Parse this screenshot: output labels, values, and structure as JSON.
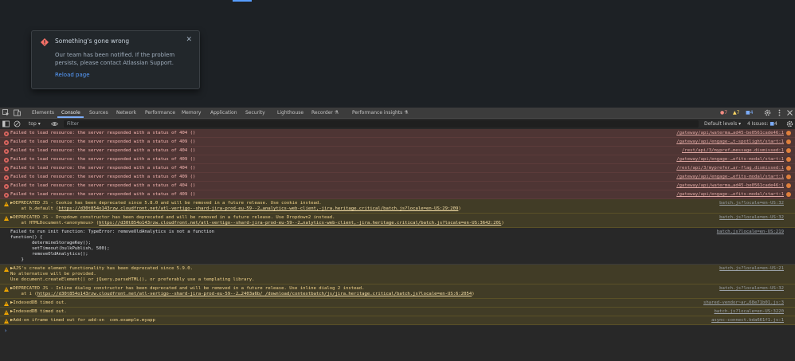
{
  "page": {
    "flag": {
      "title": "Something's gone wrong",
      "body": "Our team has been notified. If the problem persists, please contact Atlassian Support.",
      "link": "Reload page",
      "close": "✕"
    }
  },
  "devtools": {
    "tabs": [
      {
        "label": "Elements"
      },
      {
        "label": "Console"
      },
      {
        "label": "Sources"
      },
      {
        "label": "Network"
      },
      {
        "label": "Performance"
      },
      {
        "label": "Memory"
      },
      {
        "label": "Application"
      },
      {
        "label": "Security"
      },
      {
        "label": "Lighthouse"
      },
      {
        "label": "Recorder ⚗"
      },
      {
        "label": "Performance insights ⚗"
      }
    ],
    "counts": {
      "errors": "7",
      "warnings": "7",
      "messages": "4"
    },
    "filter": {
      "context": "top",
      "placeholder": "Filter",
      "levels": "Default levels ▾",
      "issues_label": "4 Issues:",
      "issues_count": "4"
    },
    "prompt": "›",
    "logs": [
      {
        "level": "error",
        "text": "Failed to load resource: the server responded with a status of 404 ()",
        "source": "/gateway/api/waterma…ad45-be0561cade46:1"
      },
      {
        "level": "error",
        "text": "Failed to load resource: the server responded with a status of 409 ()",
        "source": "/gateway/api/engage-…t-spotlight/start:1"
      },
      {
        "level": "error",
        "text": "Failed to load resource: the server responded with a status of 404 ()",
        "source": "/rest/api/3/mypref…message.dismissed:1"
      },
      {
        "level": "error",
        "text": "Failed to load resource: the server responded with a status of 409 ()",
        "source": "/gateway/api/engage-…efits-modal/start:1"
      },
      {
        "level": "error",
        "text": "Failed to load resource: the server responded with a status of 404 ()",
        "source": "/rest/api/3/myprefer…ar-flag.dismissed:1"
      },
      {
        "level": "error",
        "text": "Failed to load resource: the server responded with a status of 409 ()",
        "source": "/gateway/api/engage-…efits-modal/start:1"
      },
      {
        "level": "error",
        "text": "Failed to load resource: the server responded with a status of 404 ()",
        "source": "/gateway/api/waterma…ad45-be0561cade46:1"
      },
      {
        "level": "error",
        "text": "Failed to load resource: the server responded with a status of 409 ()",
        "source": "/gateway/api/engage-…efits-modal/start:1"
      },
      {
        "level": "warn",
        "text": "▶DEPRECATED JS - Cookie has been deprecated since 5.8.0 and will be removed in a future release. Use cookie instead.",
        "line2_prefix": "    at b.default (",
        "line2_link": "https://d30t854o143rzw.cloudfront.net/atl-vertigo--shard-jira-prod-eu-59--2…analytics-web-client,-jira.heritage.critical/batch.js?locale=en-US:29:209",
        "line2_suffix": ")",
        "source": "batch.js?locale=en-US:32"
      },
      {
        "level": "warn",
        "text": "▶DEPRECATED JS - Dropdown constructor has been deprecated and will be removed in a future release. Use Dropdown2 instead.",
        "line2_prefix": "    at HTMLDocument.<anonymous> (",
        "line2_link": "https://d30t854o143rzw.cloudfront.net/atl-vertigo--shard-jira-prod-eu-59--2…nalytics-web-client,-jira.heritage.critical/batch.js?locale=en-US:3642:201",
        "line2_suffix": ")",
        "source": "batch.js?locale=en-US:32"
      },
      {
        "level": "plain",
        "text": "Failed to run init function: TypeError: removeOldAnalytics is not a function\nfunction() {\n        determineStorageKey();\n        setTimeout(bulkPublish, 500);\n        removeOldAnalytics();\n    }",
        "source": "batch.js?locale=en-US:219"
      },
      {
        "level": "warn",
        "text": "▶AJS's create element functionality has been deprecated since 5.9.0.\nNo alternative will be provided.\nUse document.createElement() or jQuery.parseHTML(), or preferably use a templating library.",
        "source": "batch.js?locale=en-US:21"
      },
      {
        "level": "warn",
        "text": "▶DEPRECATED JS - Inline dialog constructor has been deprecated and will be removed in a future release. Use inline dialog 2 instead.",
        "line2_prefix": "    at i (",
        "line2_link": "https://d30t854o143rzw.cloudfront.net/atl-vertigo--shard-jira-prod-eu-59--2…2403a6b/_/download/contextbatch/js/jira.heritage.critical/batch.js?locale=en-US:6:2054",
        "line2_suffix": ")",
        "source": "batch.js?locale=en-US:32"
      },
      {
        "level": "warn",
        "text": "▶IndexedDB timed out.",
        "source": "shared-vendor~ar…68e71b01.js:3"
      },
      {
        "level": "warn",
        "text": "▶IndexedDB timed out.",
        "source": "batch.js?locale=en-US:3220"
      },
      {
        "level": "warn",
        "text": "▶Add-on iframe timed out for add-on  com.example.myapp",
        "source": "async-connect.bda661f1.js:1"
      }
    ]
  }
}
